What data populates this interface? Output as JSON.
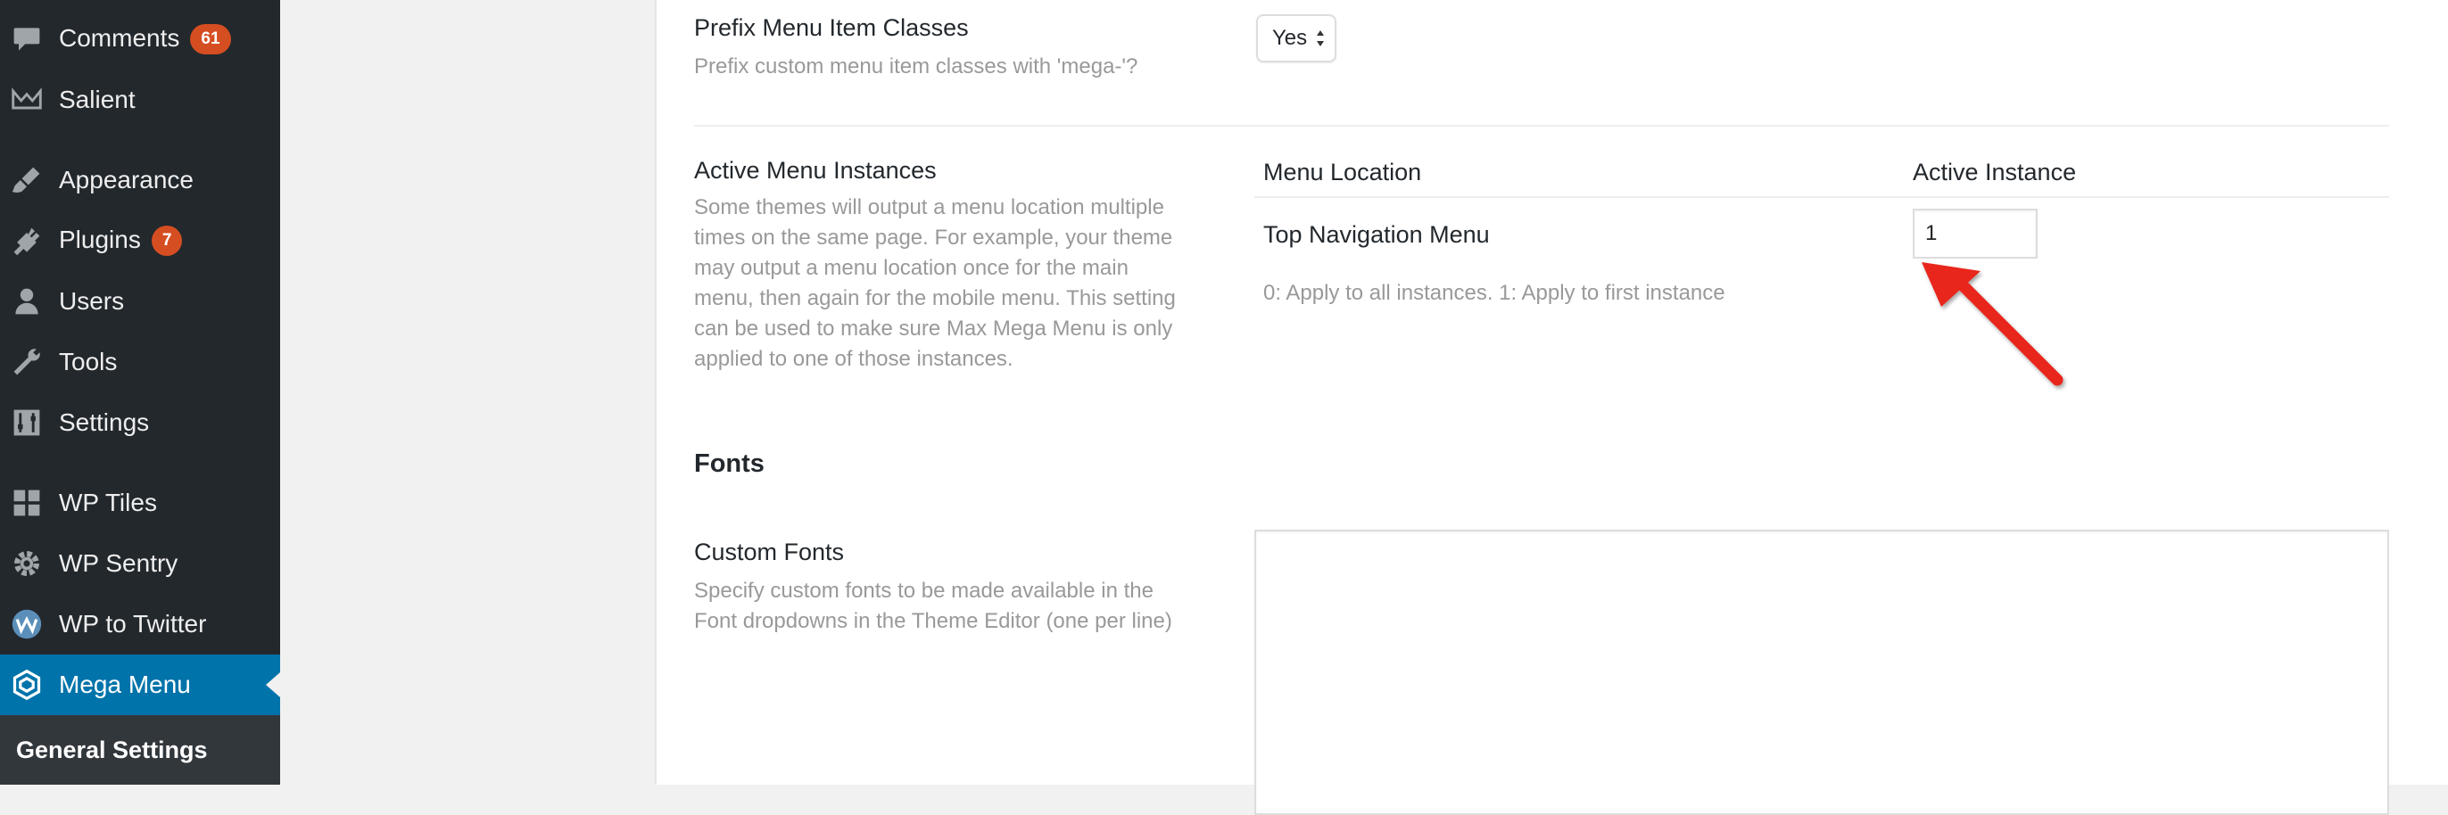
{
  "sidebar": {
    "items": [
      {
        "label": "Comments",
        "badge": "61",
        "icon": "comments-icon"
      },
      {
        "label": "Salient",
        "icon": "salient-icon"
      },
      {
        "label": "Appearance",
        "icon": "appearance-brush-icon"
      },
      {
        "label": "Plugins",
        "badge": "7",
        "icon": "plugins-icon"
      },
      {
        "label": "Users",
        "icon": "users-icon"
      },
      {
        "label": "Tools",
        "icon": "tools-wrench-icon"
      },
      {
        "label": "Settings",
        "icon": "settings-sliders-icon"
      },
      {
        "label": "WP Tiles",
        "icon": "wp-tiles-grid-icon"
      },
      {
        "label": "WP Sentry",
        "icon": "wp-sentry-gear-icon"
      },
      {
        "label": "WP to Twitter",
        "icon": "wp-to-twitter-icon"
      },
      {
        "label": "Mega Menu",
        "icon": "mega-menu-cube-icon",
        "current": true
      }
    ],
    "submenu": {
      "label": "General Settings"
    }
  },
  "settings": {
    "prefix": {
      "title": "Prefix Menu Item Classes",
      "description": "Prefix custom menu item classes with 'mega-'?",
      "value": "Yes"
    },
    "instances": {
      "title": "Active Menu Instances",
      "description_lines": [
        "Some themes will output a menu location multiple",
        "times on the same page. For example, your theme",
        "may output a menu location once for the main",
        "menu, then again for the mobile menu. This setting",
        "can be used to make sure Max Mega Menu is only",
        "applied to one of those instances."
      ],
      "col_location": "Menu Location",
      "col_instance": "Active Instance",
      "row_location": "Top Navigation Menu",
      "row_value": "1",
      "hint": "0: Apply to all instances. 1: Apply to first instance"
    },
    "fonts_section": "Fonts",
    "custom_fonts": {
      "title": "Custom Fonts",
      "description_lines": [
        "Specify custom fonts to be made available in the",
        "Font dropdowns in the Theme Editor (one per line)"
      ],
      "value": ""
    }
  },
  "colors": {
    "sidebar_bg": "#23282d",
    "current_bg": "#0073aa",
    "badge_bg": "#d54e21",
    "arrow": "#e8251b"
  }
}
